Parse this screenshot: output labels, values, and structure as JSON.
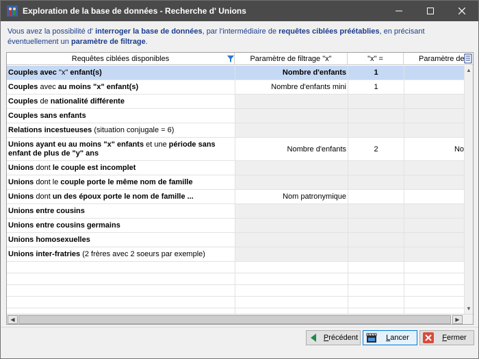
{
  "window": {
    "title": "Exploration de la base de données - Recherche d' Unions"
  },
  "intro": {
    "p1": "Vous avez la possibilité d' ",
    "b1": "interroger la base de données",
    "p2": ", par l'intermédiaire de ",
    "b2": "requêtes ciblées préétablies",
    "p3": ", en précisant éventuellement un ",
    "b3": "paramètre de filtrage",
    "p4": "."
  },
  "grid": {
    "headers": [
      "Requêtes ciblées disponibles",
      "Paramètre de filtrage \"x\"",
      "\"x\" =",
      "Paramètre de"
    ],
    "rows": [
      {
        "b1": "Couples avec ",
        "n1": "\"x\"",
        "b2": " enfant(s)",
        "n2": "",
        "b3": "",
        "n3": "",
        "param": "Nombre d'enfants",
        "x": "1",
        "p2": "",
        "selected": true,
        "editable": true
      },
      {
        "b1": "Couples",
        "n1": " avec ",
        "b2": "au moins \"x\" enfant(s)",
        "n2": "",
        "b3": "",
        "n3": "",
        "param": "Nombre d'enfants mini",
        "x": "1",
        "p2": "",
        "selected": false,
        "editable": true
      },
      {
        "b1": "Couples",
        "n1": " de ",
        "b2": "nationalité différente",
        "n2": "",
        "b3": "",
        "n3": "",
        "param": "",
        "x": "",
        "p2": "",
        "selected": false,
        "editable": false
      },
      {
        "b1": "Couples sans enfants",
        "n1": "",
        "b2": "",
        "n2": "",
        "b3": "",
        "n3": "",
        "param": "",
        "x": "",
        "p2": "",
        "selected": false,
        "editable": false
      },
      {
        "b1": "Relations incestueuses",
        "n1": " (situation conjugale = 6)",
        "b2": "",
        "n2": "",
        "b3": "",
        "n3": "",
        "param": "",
        "x": "",
        "p2": "",
        "selected": false,
        "editable": false
      },
      {
        "b1": "Unions ayant eu au moins \"x\" enfants",
        "n1": " et une ",
        "b2": "période sans enfant de plus de \"y\" ans",
        "n2": "",
        "b3": "",
        "n3": "",
        "param": "Nombre d'enfants",
        "x": "2",
        "p2": "No",
        "selected": false,
        "editable": true,
        "tall": true
      },
      {
        "b1": "Unions",
        "n1": " dont ",
        "b2": "le couple est incomplet",
        "n2": "",
        "b3": "",
        "n3": "",
        "param": "",
        "x": "",
        "p2": "",
        "selected": false,
        "editable": false
      },
      {
        "b1": "Unions",
        "n1": " dont le ",
        "b2": "couple porte le même nom de famille",
        "n2": "",
        "b3": "",
        "n3": "",
        "param": "",
        "x": "",
        "p2": "",
        "selected": false,
        "editable": false
      },
      {
        "b1": "Unions",
        "n1": " dont ",
        "b2": "un des époux porte le nom de famille ...",
        "n2": "",
        "b3": "",
        "n3": "",
        "param": "Nom patronymique",
        "x": "",
        "p2": "",
        "selected": false,
        "editable": true
      },
      {
        "b1": "Unions entre cousins",
        "n1": "",
        "b2": "",
        "n2": "",
        "b3": "",
        "n3": "",
        "param": "",
        "x": "",
        "p2": "",
        "selected": false,
        "editable": false
      },
      {
        "b1": "Unions entre cousins germains",
        "n1": "",
        "b2": "",
        "n2": "",
        "b3": "",
        "n3": "",
        "param": "",
        "x": "",
        "p2": "",
        "selected": false,
        "editable": false
      },
      {
        "b1": "Unions homosexuelles",
        "n1": "",
        "b2": "",
        "n2": "",
        "b3": "",
        "n3": "",
        "param": "",
        "x": "",
        "p2": "",
        "selected": false,
        "editable": false
      },
      {
        "b1": "Unions inter-fratries",
        "n1": " (2 frères avec 2 soeurs par exemple)",
        "b2": "",
        "n2": "",
        "b3": "",
        "n3": "",
        "param": "",
        "x": "",
        "p2": "",
        "selected": false,
        "editable": false
      }
    ],
    "empty_rows": 5
  },
  "buttons": {
    "prev": {
      "pre": "",
      "u": "P",
      "post": "récédent"
    },
    "go": {
      "pre": "",
      "u": "L",
      "post": "ancer"
    },
    "close": {
      "pre": "",
      "u": "F",
      "post": "ermer"
    }
  },
  "colors": {
    "intro_text": "#1c3c8c",
    "selection": "#c5d9f5",
    "titlebar": "#4a4a4a"
  },
  "icons": {
    "app": "family-tree-icon",
    "filter": "filter-funnel-icon",
    "prev": "arrow-left-icon",
    "go": "clapperboard-icon",
    "close": "close-x-icon"
  }
}
